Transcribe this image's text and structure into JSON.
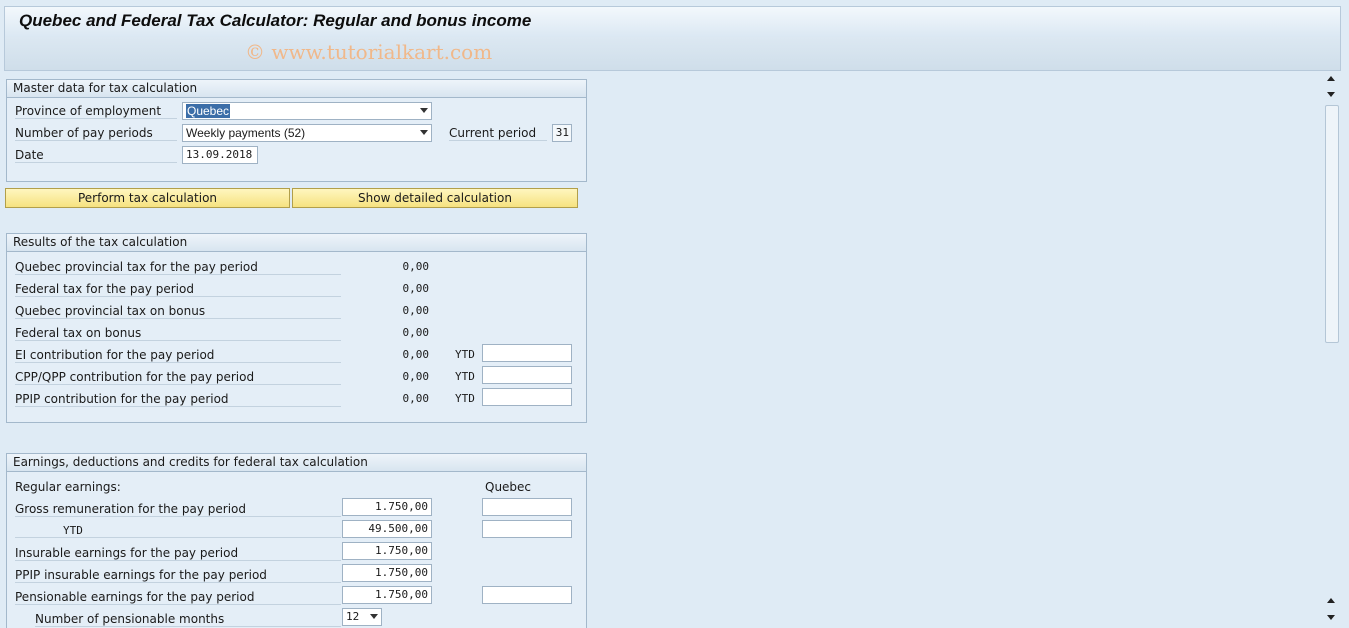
{
  "window": {
    "title": "Quebec and Federal Tax Calculator: Regular and bonus income",
    "watermark": "© www.tutorialkart.com"
  },
  "master": {
    "header": "Master data for tax calculation",
    "province_label": "Province of employment",
    "province_value": "Quebec",
    "periods_label": "Number of pay periods",
    "periods_value": "Weekly payments (52)",
    "current_period_label": "Current period",
    "current_period_value": "31",
    "date_label": "Date",
    "date_value": "13.09.2018"
  },
  "buttons": {
    "perform": "Perform tax calculation",
    "show_detail": "Show detailed calculation"
  },
  "results": {
    "header": "Results of the tax calculation",
    "ytd_label": "YTD",
    "rows": [
      {
        "label": "Quebec provincial tax for the pay period",
        "value": "0,00"
      },
      {
        "label": "Federal tax for the pay period",
        "value": "0,00"
      },
      {
        "label": "Quebec provincial tax on bonus",
        "value": "0,00"
      },
      {
        "label": "Federal tax on bonus",
        "value": "0,00"
      },
      {
        "label": "EI contribution for the pay period",
        "value": "0,00"
      },
      {
        "label": "CPP/QPP contribution for the pay period",
        "value": "0,00"
      },
      {
        "label": "PPIP contribution for the pay period",
        "value": "0,00"
      }
    ]
  },
  "earnings": {
    "header": "Earnings, deductions and credits for federal tax calculation",
    "regular_label": "Regular earnings:",
    "quebec_col": "Quebec",
    "gross_label": "Gross remuneration for the pay period",
    "gross_value": "1.750,00",
    "ytd_label": "YTD",
    "ytd_value": "49.500,00",
    "insurable_label": "Insurable earnings for the pay period",
    "insurable_value": "1.750,00",
    "ppip_label": "PPIP insurable earnings for the pay period",
    "ppip_value": "1.750,00",
    "pensionable_label": "Pensionable earnings for the pay period",
    "pensionable_value": "1.750,00",
    "months_label": "Number of pensionable months",
    "months_value": "12"
  }
}
